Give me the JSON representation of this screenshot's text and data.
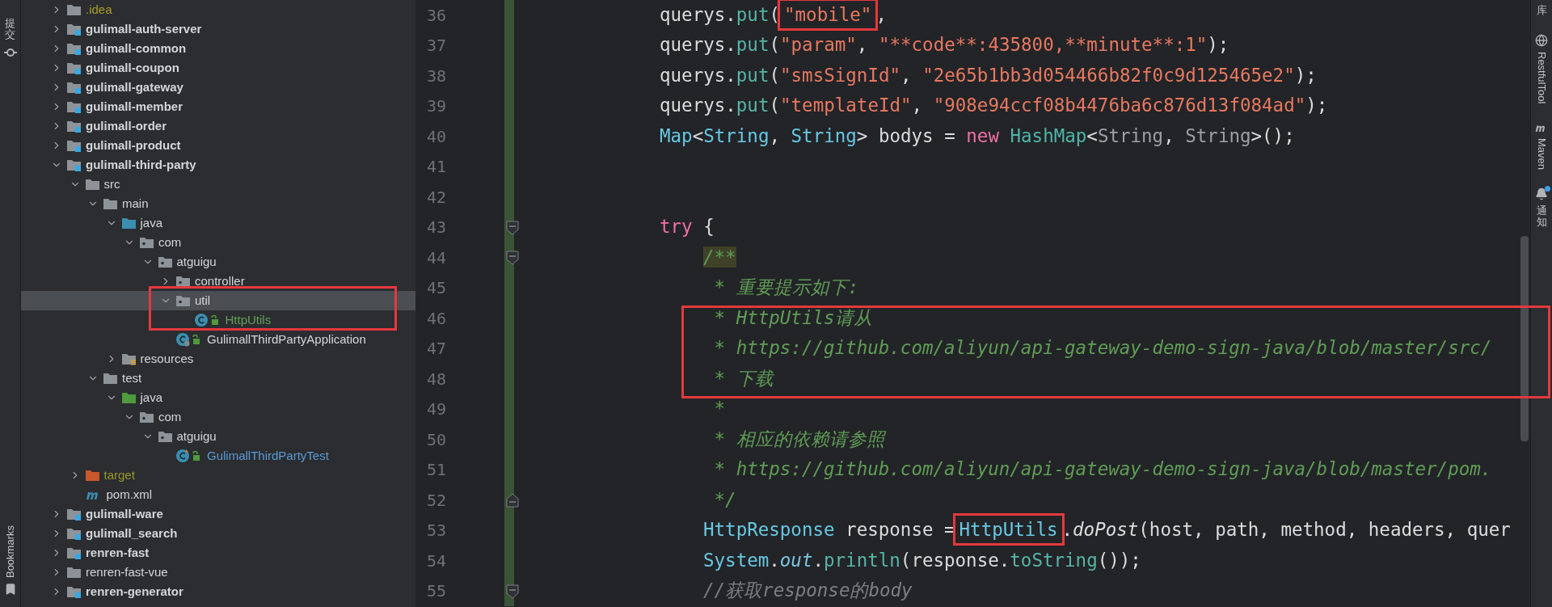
{
  "left_toolbar": [
    {
      "label": "提交",
      "kind": "commit"
    },
    {
      "label": "Bookmarks",
      "kind": "bookmarks"
    }
  ],
  "project_tree": [
    {
      "label": ".idea",
      "kind": "config-folder",
      "expanded": false,
      "selected": false
    },
    {
      "label": "gulimall-auth-server",
      "kind": "module",
      "expanded": false,
      "selected": false
    },
    {
      "label": "gulimall-common",
      "kind": "module",
      "expanded": false,
      "selected": false
    },
    {
      "label": "gulimall-coupon",
      "kind": "module",
      "expanded": false,
      "selected": false
    },
    {
      "label": "gulimall-gateway",
      "kind": "module",
      "expanded": false,
      "selected": false
    },
    {
      "label": "gulimall-member",
      "kind": "module",
      "expanded": false,
      "selected": false
    },
    {
      "label": "gulimall-order",
      "kind": "module",
      "expanded": false,
      "selected": false
    },
    {
      "label": "gulimall-product",
      "kind": "module",
      "expanded": false,
      "selected": false
    },
    {
      "label": "gulimall-third-party",
      "kind": "module",
      "expanded": true,
      "selected": false,
      "children": [
        {
          "label": "src",
          "kind": "folder",
          "expanded": true,
          "selected": false,
          "children": [
            {
              "label": "main",
              "kind": "folder",
              "expanded": true,
              "selected": false,
              "children": [
                {
                  "label": "java",
                  "kind": "source-folder",
                  "expanded": true,
                  "selected": false,
                  "children": [
                    {
                      "label": "com",
                      "kind": "package",
                      "expanded": true,
                      "selected": false,
                      "children": [
                        {
                          "label": "atguigu",
                          "kind": "package",
                          "expanded": true,
                          "selected": false,
                          "children": [
                            {
                              "label": "controller",
                              "kind": "package",
                              "expanded": false,
                              "selected": false
                            },
                            {
                              "label": "util",
                              "kind": "package",
                              "expanded": true,
                              "selected": true,
                              "framed": true,
                              "children": [
                                {
                                  "label": "HttpUtils",
                                  "kind": "class",
                                  "selected": false,
                                  "color": "#62a15a"
                                }
                              ]
                            },
                            {
                              "label": "GulimallThirdPartyApplication",
                              "kind": "app-class",
                              "selected": false
                            }
                          ]
                        }
                      ]
                    }
                  ]
                },
                {
                  "label": "resources",
                  "kind": "resources-folder",
                  "expanded": false,
                  "selected": false
                }
              ]
            },
            {
              "label": "test",
              "kind": "folder",
              "expanded": true,
              "selected": false,
              "children": [
                {
                  "label": "java",
                  "kind": "test-folder",
                  "expanded": true,
                  "selected": false,
                  "children": [
                    {
                      "label": "com",
                      "kind": "package",
                      "expanded": true,
                      "selected": false,
                      "children": [
                        {
                          "label": "atguigu",
                          "kind": "package",
                          "expanded": true,
                          "selected": false,
                          "children": [
                            {
                              "label": "GulimallThirdPartyTest",
                              "kind": "test-class",
                              "selected": false,
                              "color": "#5b9bd5"
                            }
                          ]
                        }
                      ]
                    }
                  ]
                }
              ]
            }
          ]
        },
        {
          "label": "target",
          "kind": "excluded-folder",
          "expanded": false,
          "selected": false,
          "color": "#9a9a2a"
        },
        {
          "label": "pom.xml",
          "kind": "pom",
          "selected": false
        }
      ]
    },
    {
      "label": "gulimall-ware",
      "kind": "module",
      "expanded": false,
      "selected": false
    },
    {
      "label": "gulimall_search",
      "kind": "module",
      "expanded": false,
      "selected": false
    },
    {
      "label": "renren-fast",
      "kind": "module",
      "expanded": false,
      "selected": false
    },
    {
      "label": "renren-fast-vue",
      "kind": "folder",
      "expanded": false,
      "selected": false
    },
    {
      "label": "renren-generator",
      "kind": "module",
      "expanded": false,
      "selected": false
    }
  ],
  "editor": {
    "lines": [
      {
        "number": "36",
        "kind": "top",
        "changed": true,
        "tokens": [
          {
            "text": "querys.",
            "kind": "plain"
          },
          {
            "text": "put",
            "kind": "call"
          },
          {
            "text": "(",
            "kind": "plain"
          },
          {
            "text": "\"mobile\"",
            "kind": "str",
            "framed": true
          },
          {
            "text": ",",
            "kind": "plain"
          }
        ]
      },
      {
        "number": "37",
        "kind": "top",
        "changed": true,
        "tokens": [
          {
            "text": "querys.",
            "kind": "plain"
          },
          {
            "text": "put",
            "kind": "call"
          },
          {
            "text": "(",
            "kind": "plain"
          },
          {
            "text": "\"param\"",
            "kind": "str"
          },
          {
            "text": ", ",
            "kind": "plain"
          },
          {
            "text": "\"**code**:435800,**minute**:1\"",
            "kind": "str"
          },
          {
            "text": ");",
            "kind": "plain"
          }
        ]
      },
      {
        "number": "38",
        "kind": "top",
        "changed": true,
        "tokens": [
          {
            "text": "querys.",
            "kind": "plain"
          },
          {
            "text": "put",
            "kind": "call"
          },
          {
            "text": "(",
            "kind": "plain"
          },
          {
            "text": "\"smsSignId\"",
            "kind": "str"
          },
          {
            "text": ", ",
            "kind": "plain"
          },
          {
            "text": "\"2e65b1bb3d054466b82f0c9d125465e2\"",
            "kind": "str"
          },
          {
            "text": ");",
            "kind": "plain"
          }
        ]
      },
      {
        "number": "39",
        "kind": "top",
        "changed": true,
        "tokens": [
          {
            "text": "querys.",
            "kind": "plain"
          },
          {
            "text": "put",
            "kind": "call"
          },
          {
            "text": "(",
            "kind": "plain"
          },
          {
            "text": "\"templateId\"",
            "kind": "str"
          },
          {
            "text": ", ",
            "kind": "plain"
          },
          {
            "text": "\"908e94ccf08b4476ba6c876d13f084ad\"",
            "kind": "str"
          },
          {
            "text": ");",
            "kind": "plain"
          }
        ]
      },
      {
        "number": "40",
        "kind": "top",
        "changed": true,
        "tokens": [
          {
            "text": "Map",
            "kind": "type"
          },
          {
            "text": "<",
            "kind": "plain"
          },
          {
            "text": "String",
            "kind": "type"
          },
          {
            "text": ", ",
            "kind": "plain"
          },
          {
            "text": "String",
            "kind": "type"
          },
          {
            "text": "> bodys = ",
            "kind": "plain"
          },
          {
            "text": "new",
            "kind": "kw"
          },
          {
            "text": " HashMap",
            "kind": "ctor"
          },
          {
            "text": "<",
            "kind": "plain"
          },
          {
            "text": "String",
            "kind": "dim"
          },
          {
            "text": ", ",
            "kind": "plain"
          },
          {
            "text": "String",
            "kind": "dim"
          },
          {
            "text": ">();",
            "kind": "plain"
          }
        ]
      },
      {
        "number": "41",
        "kind": "top",
        "changed": true
      },
      {
        "number": "42",
        "kind": "top",
        "changed": true
      },
      {
        "number": "43",
        "kind": "top",
        "changed": true,
        "fold_start": true,
        "tokens": [
          {
            "text": "try",
            "kind": "kw"
          },
          {
            "text": " {",
            "kind": "plain"
          }
        ]
      },
      {
        "number": "44",
        "kind": "body",
        "changed": true,
        "fold_start": true,
        "tokens": [
          {
            "text": "/**",
            "kind": "comment",
            "highlighted": true
          }
        ]
      },
      {
        "number": "45",
        "kind": "body",
        "changed": true,
        "tokens": [
          {
            "text": " * 重要提示如下:",
            "kind": "comment"
          }
        ]
      },
      {
        "number": "46",
        "kind": "body",
        "changed": true,
        "framed": true,
        "tokens": [
          {
            "text": " * HttpUtils请从",
            "kind": "comment"
          }
        ]
      },
      {
        "number": "47",
        "kind": "body",
        "changed": true,
        "framed": true,
        "tokens": [
          {
            "text": " * https://github.com/aliyun/api-gateway-demo-sign-java/blob/master/src/",
            "kind": "comment"
          }
        ]
      },
      {
        "number": "48",
        "kind": "body",
        "changed": true,
        "framed": true,
        "tokens": [
          {
            "text": " * 下载",
            "kind": "comment"
          }
        ]
      },
      {
        "number": "49",
        "kind": "body",
        "changed": true,
        "tokens": [
          {
            "text": " *",
            "kind": "comment"
          }
        ]
      },
      {
        "number": "50",
        "kind": "body",
        "changed": true,
        "tokens": [
          {
            "text": " * 相应的依赖请参照",
            "kind": "comment"
          }
        ]
      },
      {
        "number": "51",
        "kind": "body",
        "changed": true,
        "tokens": [
          {
            "text": " * https://github.com/aliyun/api-gateway-demo-sign-java/blob/master/pom.",
            "kind": "comment"
          }
        ]
      },
      {
        "number": "52",
        "kind": "body",
        "changed": true,
        "fold_end": true,
        "tokens": [
          {
            "text": " */",
            "kind": "comment"
          }
        ]
      },
      {
        "number": "53",
        "kind": "body",
        "changed": true,
        "tokens": [
          {
            "text": "HttpResponse",
            "kind": "type"
          },
          {
            "text": " response =",
            "kind": "plain"
          },
          {
            "text": "HttpUtils",
            "kind": "type",
            "framed": true
          },
          {
            "text": ".",
            "kind": "plain"
          },
          {
            "text": "doPost",
            "kind": "static-call"
          },
          {
            "text": "(host, path, method, headers, quer",
            "kind": "plain"
          }
        ]
      },
      {
        "number": "54",
        "kind": "body",
        "changed": true,
        "tokens": [
          {
            "text": "System",
            "kind": "type"
          },
          {
            "text": ".",
            "kind": "plain"
          },
          {
            "text": "out",
            "kind": "static-field"
          },
          {
            "text": ".",
            "kind": "plain"
          },
          {
            "text": "println",
            "kind": "call"
          },
          {
            "text": "(response.",
            "kind": "plain"
          },
          {
            "text": "toString",
            "kind": "call"
          },
          {
            "text": "());",
            "kind": "plain"
          }
        ]
      },
      {
        "number": "55",
        "kind": "body",
        "changed": true,
        "fold_start": true,
        "tokens": [
          {
            "text": "//获取response的body",
            "kind": "line-comment"
          }
        ]
      }
    ]
  },
  "right_toolbar": [
    {
      "label": "库",
      "kind": "plain"
    },
    {
      "label": "RestfulTool",
      "kind": "restful"
    },
    {
      "label": "Maven",
      "kind": "maven"
    },
    {
      "label": "通知",
      "kind": "notifications",
      "unread": true
    }
  ]
}
